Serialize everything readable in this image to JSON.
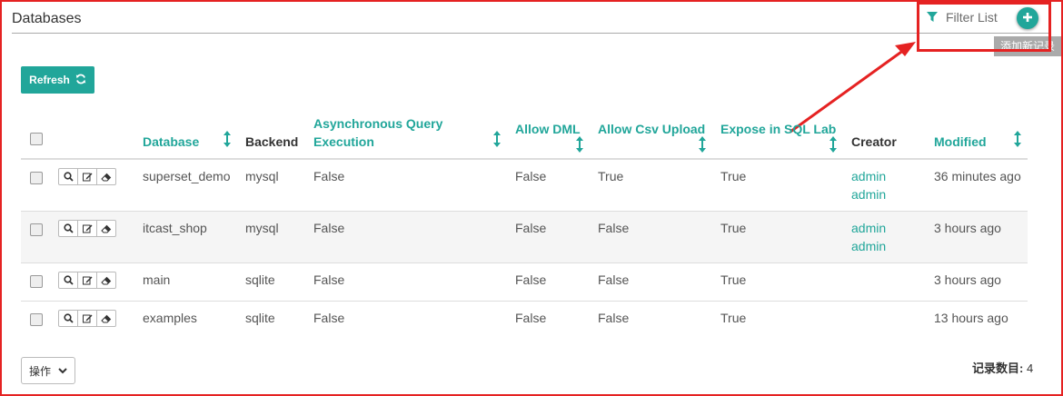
{
  "page": {
    "title": "Databases"
  },
  "toolbar": {
    "filter_label": "Filter List",
    "add_tooltip": "添加新记录",
    "refresh_label": "Refresh"
  },
  "table": {
    "columns": [
      "Database",
      "Backend",
      "Asynchronous Query Execution",
      "Allow DML",
      "Allow Csv Upload",
      "Expose in SQL Lab",
      "Creator",
      "Modified"
    ],
    "rows": [
      {
        "database": "superset_demo",
        "backend": "mysql",
        "async": "False",
        "dml": "False",
        "csv": "True",
        "expose": "True",
        "creator": "admin",
        "creator2": "admin",
        "modified": "36 minutes ago"
      },
      {
        "database": "itcast_shop",
        "backend": "mysql",
        "async": "False",
        "dml": "False",
        "csv": "False",
        "expose": "True",
        "creator": "admin",
        "creator2": "admin",
        "modified": "3 hours ago"
      },
      {
        "database": "main",
        "backend": "sqlite",
        "async": "False",
        "dml": "False",
        "csv": "False",
        "expose": "True",
        "creator": "",
        "creator2": "",
        "modified": "3 hours ago"
      },
      {
        "database": "examples",
        "backend": "sqlite",
        "async": "False",
        "dml": "False",
        "csv": "False",
        "expose": "True",
        "creator": "",
        "creator2": "",
        "modified": "13 hours ago"
      }
    ]
  },
  "footer": {
    "actions_label": "操作",
    "record_count_label": "记录数目:",
    "record_count": "4"
  },
  "colors": {
    "accent": "#21a69a",
    "annotation": "#e52222"
  }
}
